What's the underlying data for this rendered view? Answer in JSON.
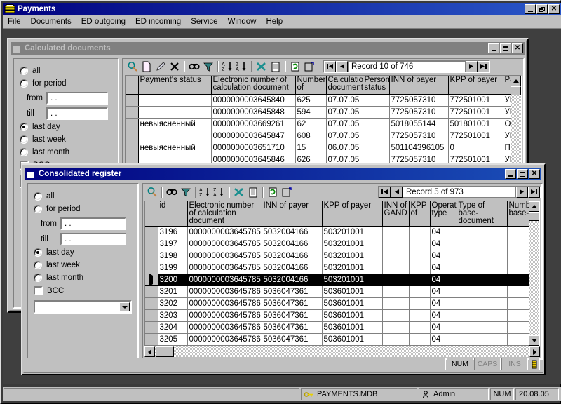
{
  "app": {
    "title": "Payments",
    "icon": "payments-app-icon",
    "window_buttons": [
      "minimize",
      "restore",
      "close"
    ]
  },
  "menu": {
    "items": [
      "File",
      "Documents",
      "ED outgoing",
      "ED incoming",
      "Service",
      "Window",
      "Help"
    ]
  },
  "colors": {
    "active_title": "#00007f",
    "inactive_title": "#808080",
    "face": "#c0c0c0",
    "desktop": "#3f3f3f",
    "selection": "#000000"
  },
  "window1": {
    "title": "Calculated documents",
    "active": false,
    "window_buttons": [
      "minimize",
      "maximize",
      "close"
    ],
    "filter": {
      "options": [
        {
          "label": "all",
          "selected": false
        },
        {
          "label": "for period",
          "selected": false
        },
        {
          "label": "last day",
          "selected": true
        },
        {
          "label": "last week",
          "selected": false
        },
        {
          "label": "last month",
          "selected": false
        }
      ],
      "from_label": "from",
      "from_value": "  .  .",
      "till_label": "till",
      "till_value": "  .  .",
      "checkbox_label": "BCC",
      "checkbox_checked": false,
      "combo_value": ""
    },
    "toolbar": {
      "buttons": [
        "search-icon",
        "new-document-icon",
        "edit-icon",
        "delete-icon",
        "find-icon",
        "filter-icon",
        "sort-asc-icon",
        "sort-desc-icon",
        "export-excel-icon",
        "report-icon",
        "refresh-icon",
        "properties-icon"
      ]
    },
    "nav": {
      "first_label": "first-record",
      "prev_label": "previous-record",
      "record_text": "Record 10 of 746",
      "next_label": "next-record",
      "last_label": "last-record"
    },
    "table": {
      "columns": [
        "",
        "Payment's status",
        "Electronic number of calculation document",
        "Number of",
        "Calculation document",
        "Person status",
        "INN of payer",
        "KPP of payer",
        "Payer name"
      ],
      "rows": [
        [
          "",
          "",
          "0000000003645840",
          "625",
          "07.07.05",
          "",
          "7725057310",
          "772501001",
          "УПРАВЛЕН"
        ],
        [
          "",
          "",
          "0000000003645848",
          "594",
          "07.07.05",
          "",
          "7725057310",
          "772501001",
          "УПРАВЛЕН"
        ],
        [
          "",
          "невыясненный",
          "0000000003669261",
          "62",
          "07.07.05",
          "",
          "5018055144",
          "501801001",
          "ООО\"АРКА"
        ],
        [
          "",
          "",
          "0000000003645847",
          "608",
          "07.07.05",
          "",
          "7725057310",
          "772501001",
          "УПРАВЛЕН"
        ],
        [
          "",
          "невыясненный",
          "0000000003651710",
          "15",
          "06.07.05",
          "",
          "501104396105",
          "0",
          "ПБОЮЛ Ст"
        ],
        [
          "",
          "",
          "0000000003645846",
          "626",
          "07.07.05",
          "",
          "7725057310",
          "772501001",
          "УПРАВЛЕН"
        ]
      ]
    }
  },
  "window2": {
    "title": "Consolidated register",
    "active": true,
    "window_buttons": [
      "minimize",
      "maximize",
      "close"
    ],
    "filter": {
      "options": [
        {
          "label": "all",
          "selected": false
        },
        {
          "label": "for period",
          "selected": false
        },
        {
          "label": "last day",
          "selected": true
        },
        {
          "label": "last week",
          "selected": false
        },
        {
          "label": "last month",
          "selected": false
        }
      ],
      "from_label": "from",
      "from_value": "  .  .",
      "till_label": "till",
      "till_value": "  .  .",
      "checkbox_label": "BCC",
      "checkbox_checked": false,
      "combo_value": ""
    },
    "toolbar": {
      "buttons": [
        "search-icon",
        "find-icon",
        "filter-icon",
        "sort-asc-icon",
        "sort-desc-icon",
        "export-excel-icon",
        "report-icon",
        "refresh-icon",
        "properties-icon"
      ]
    },
    "nav": {
      "first_label": "first-record",
      "prev_label": "previous-record",
      "record_text": "Record 5 of 973",
      "next_label": "next-record",
      "last_label": "last-record"
    },
    "table": {
      "columns": [
        "",
        "id",
        "Electronic number of calculation document",
        "INN of payer",
        "KPP of payer",
        "INN of GAND",
        "KPP of",
        "Operation type",
        "Type of base-document",
        "Number base-"
      ],
      "rows": [
        {
          "selected": false,
          "cells": [
            "",
            "3196",
            "0000000003645785",
            "5032004166",
            "503201001",
            "",
            "",
            "04",
            "",
            ""
          ]
        },
        {
          "selected": false,
          "cells": [
            "",
            "3197",
            "0000000003645785",
            "5032004166",
            "503201001",
            "",
            "",
            "04",
            "",
            ""
          ]
        },
        {
          "selected": false,
          "cells": [
            "",
            "3198",
            "0000000003645785",
            "5032004166",
            "503201001",
            "",
            "",
            "04",
            "",
            ""
          ]
        },
        {
          "selected": false,
          "cells": [
            "",
            "3199",
            "0000000003645785",
            "5032004166",
            "503201001",
            "",
            "",
            "04",
            "",
            ""
          ]
        },
        {
          "selected": true,
          "cells": [
            "",
            "3200",
            "0000000003645785",
            "5032004166",
            "503201001",
            "",
            "",
            "04",
            "",
            ""
          ]
        },
        {
          "selected": false,
          "cells": [
            "",
            "3201",
            "0000000003645786",
            "5036047361",
            "503601001",
            "",
            "",
            "04",
            "",
            ""
          ]
        },
        {
          "selected": false,
          "cells": [
            "",
            "3202",
            "0000000003645786",
            "5036047361",
            "503601001",
            "",
            "",
            "04",
            "",
            ""
          ]
        },
        {
          "selected": false,
          "cells": [
            "",
            "3203",
            "0000000003645786",
            "5036047361",
            "503601001",
            "",
            "",
            "04",
            "",
            ""
          ]
        },
        {
          "selected": false,
          "cells": [
            "",
            "3204",
            "0000000003645786",
            "5036047361",
            "503601001",
            "",
            "",
            "04",
            "",
            ""
          ]
        },
        {
          "selected": false,
          "cells": [
            "",
            "3205",
            "0000000003645786",
            "5036047361",
            "503601001",
            "",
            "",
            "04",
            "",
            ""
          ]
        }
      ]
    },
    "status": {
      "message": "",
      "num": "NUM",
      "caps": "CAPS",
      "ins": "INS",
      "resize_grip": "resize-grip-icon"
    }
  },
  "statusbar": {
    "message": "",
    "database_icon": "key-icon",
    "database": "PAYMENTS.MDB",
    "user_icon": "user-icon",
    "user": "Admin",
    "num": "NUM",
    "date": "20.08.05"
  }
}
